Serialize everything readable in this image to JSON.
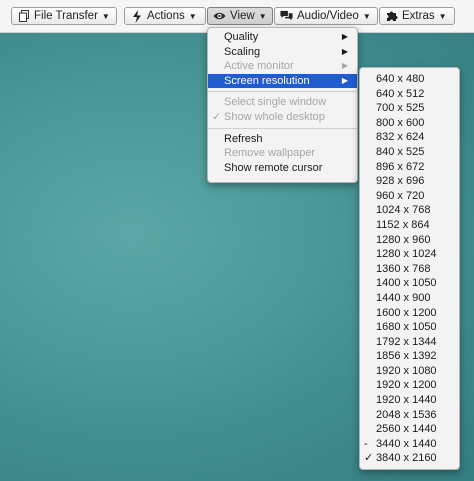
{
  "toolbar": {
    "buttons": [
      {
        "label": "File Transfer",
        "icon": "file-copy-icon"
      },
      {
        "label": "Actions",
        "icon": "lightning-icon"
      },
      {
        "label": "View",
        "icon": "eye-icon"
      },
      {
        "label": "Audio/Video",
        "icon": "chat-bubbles-icon"
      },
      {
        "label": "Extras",
        "icon": "puzzle-icon"
      }
    ]
  },
  "view_menu": {
    "items": [
      {
        "label": "Quality",
        "state": "enabled",
        "submenu": true
      },
      {
        "label": "Scaling",
        "state": "enabled",
        "submenu": true
      },
      {
        "label": "Active monitor",
        "state": "disabled",
        "submenu": true
      },
      {
        "label": "Screen resolution",
        "state": "selected",
        "submenu": true
      },
      {
        "label": "Select single window",
        "state": "disabled"
      },
      {
        "label": "Show whole desktop",
        "state": "disabled",
        "mark": "✓"
      },
      {
        "label": "Refresh",
        "state": "enabled"
      },
      {
        "label": "Remove wallpaper",
        "state": "disabled"
      },
      {
        "label": "Show remote cursor",
        "state": "enabled"
      }
    ]
  },
  "resolution_menu": {
    "items": [
      {
        "label": "640 x 480"
      },
      {
        "label": "640 x 512"
      },
      {
        "label": "700 x 525"
      },
      {
        "label": "800 x 600"
      },
      {
        "label": "832 x 624"
      },
      {
        "label": "840 x 525"
      },
      {
        "label": "896 x 672"
      },
      {
        "label": "928 x 696"
      },
      {
        "label": "960 x 720"
      },
      {
        "label": "1024 x 768"
      },
      {
        "label": "1152 x 864"
      },
      {
        "label": "1280 x 960"
      },
      {
        "label": "1280 x 1024"
      },
      {
        "label": "1360 x 768"
      },
      {
        "label": "1400 x 1050"
      },
      {
        "label": "1440 x 900"
      },
      {
        "label": "1600 x 1200"
      },
      {
        "label": "1680 x 1050"
      },
      {
        "label": "1792 x 1344"
      },
      {
        "label": "1856 x 1392"
      },
      {
        "label": "1920 x 1080"
      },
      {
        "label": "1920 x 1200"
      },
      {
        "label": "1920 x 1440"
      },
      {
        "label": "2048 x 1536"
      },
      {
        "label": "2560 x 1440"
      },
      {
        "label": "3440 x 1440",
        "mark": "-"
      },
      {
        "label": "3840 x 2160",
        "mark": "✓"
      }
    ]
  },
  "colors": {
    "desktop": "#4a9898",
    "selection": "#1f5bd1",
    "toolbar": "#f5f5f5"
  }
}
